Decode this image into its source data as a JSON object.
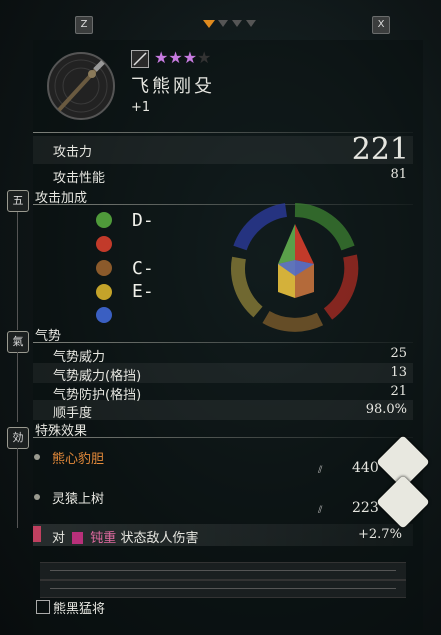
{
  "header": {
    "key_left": "Z",
    "key_right": "X",
    "page_indicator": {
      "active": 1,
      "total": 4
    }
  },
  "weapon": {
    "name": "飞熊刚殳",
    "upgrade": "+1",
    "stars": "★★★",
    "stars_filled": 3,
    "stars_total": 4,
    "type_icon": "polearm-icon"
  },
  "stats": {
    "attack_power_label": "攻击力",
    "attack_power_value": "221",
    "attack_perf_label": "攻击性能",
    "attack_perf_value": "81"
  },
  "bonus": {
    "section_icon": "五",
    "title": "攻击加成",
    "items": [
      {
        "icon": "wood-phase-icon",
        "color": "#4f9a3a",
        "grade": "D-"
      },
      {
        "icon": "fire-phase-icon",
        "color": "#c23a2a",
        "grade": ""
      },
      {
        "icon": "earth-phase-icon",
        "color": "#8b5a2b",
        "grade": "C-"
      },
      {
        "icon": "metal-phase-icon",
        "color": "#c4a32a",
        "grade": "E-"
      },
      {
        "icon": "water-phase-icon",
        "color": "#3a5fc2",
        "grade": ""
      }
    ]
  },
  "spirit": {
    "section_icon": "氣",
    "title": "气势",
    "rows": [
      {
        "label": "气势威力",
        "value": "25"
      },
      {
        "label": "气势威力(格挡)",
        "value": "13"
      },
      {
        "label": "气势防护(格挡)",
        "value": "21"
      },
      {
        "label": "顺手度",
        "value": "98.0%"
      }
    ]
  },
  "effects": {
    "section_icon": "効",
    "title": "特殊效果",
    "items": [
      {
        "name": "熊心豹胆",
        "value": "440",
        "name_color": "#e58a3a"
      },
      {
        "name": "灵猿上树",
        "value": "223",
        "name_color": "#e6e6e0"
      }
    ],
    "bonus_line": {
      "prefix": "对",
      "status": "钝重",
      "suffix": "状态敌人伤害",
      "value": "+2.7%"
    }
  },
  "set_name": "熊黑猛将",
  "colors": {
    "accent": "#e08a1e",
    "star": "#c77be0"
  }
}
